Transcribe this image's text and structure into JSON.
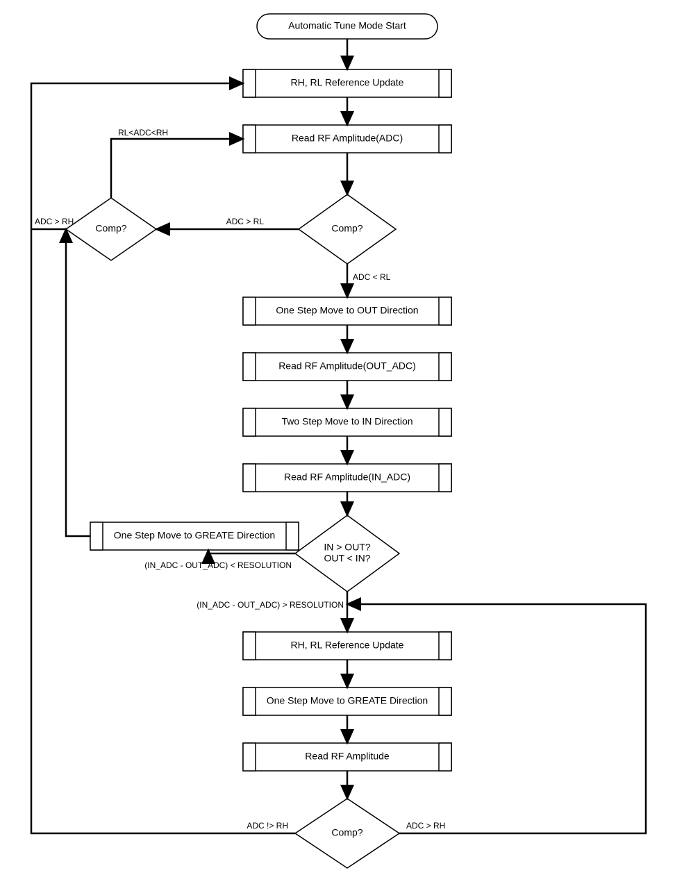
{
  "nodes": {
    "start": "Automatic Tune Mode Start",
    "ref1": "RH, RL Reference Update",
    "read1": "Read RF Amplitude(ADC)",
    "comp1": "Comp?",
    "comp2": "Comp?",
    "out1": "One Step Move to OUT Direction",
    "read2": "Read RF Amplitude(OUT_ADC)",
    "in2": "Two Step Move to IN Direction",
    "read3": "Read RF Amplitude(IN_ADC)",
    "comp3a": "IN > OUT?",
    "comp3b": "OUT < IN?",
    "greate1": "One Step Move to GREATE Direction",
    "ref2": "RH, RL Reference Update",
    "greate2": "One Step Move to GREATE Direction",
    "read4": "Read RF Amplitude",
    "comp4": "Comp?"
  },
  "edges": {
    "e1": "ADC > RL",
    "e2": "ADC < RL",
    "e3": "RL<ADC<RH",
    "e4": "ADC > RH",
    "e5": "(IN_ADC - OUT_ADC) < RESOLUTION",
    "e6": "(IN_ADC - OUT_ADC) > RESOLUTION",
    "e7": "ADC !> RH",
    "e8": "ADC > RH"
  }
}
